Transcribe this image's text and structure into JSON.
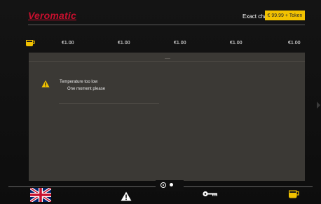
{
  "header": {
    "brand": "Veromatic",
    "exact_change_label": "Exact change",
    "token_badge": "€ 99.99 + Token"
  },
  "prices": [
    "€1.00",
    "€1.00",
    "€1.00",
    "€1.00",
    "€1.00"
  ],
  "alert": {
    "title": "Temperature too low",
    "subtitle": "One moment please"
  },
  "pager": {
    "current": 1,
    "total": 2
  },
  "colors": {
    "brand": "#c8102e",
    "badge": "#f2c200",
    "panel": "#3b3935",
    "icon_accent": "#f2c200"
  },
  "icons": [
    "coffee-cup-icon",
    "warning-icon",
    "uk-flag-icon",
    "key-icon"
  ]
}
